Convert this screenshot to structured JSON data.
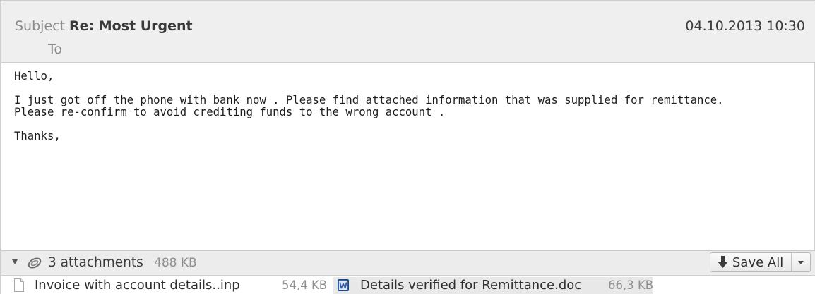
{
  "header": {
    "subject_label": "Subject",
    "subject": "Re: Most Urgent",
    "date": "04.10.2013 10:30",
    "to_label": "To"
  },
  "body": {
    "lines": [
      "Hello,",
      "",
      "I just got off the phone with bank now . Please find attached information that was supplied for remittance.",
      "Please re-confirm to avoid crediting funds to the wrong account .",
      "",
      "Thanks,"
    ]
  },
  "attachments": {
    "count_label": "3 attachments",
    "total_size": "488 KB",
    "save_all_label": "Save All",
    "icons": {
      "collapse": "triangle-down-icon",
      "paperclip": "paperclip-icon",
      "save": "download-arrow-icon",
      "dropdown": "chevron-down-icon"
    },
    "files": [
      {
        "name": "Invoice with account details..inp",
        "size": "54,4 KB",
        "icon": "generic-file-icon"
      },
      {
        "name": "Details verified for Remittance.doc",
        "size": "66,3 KB",
        "icon": "word-doc-icon"
      }
    ]
  },
  "colors": {
    "header_bg": "#efefef",
    "attach_bar_bg": "#ececec",
    "selected_attachment_bg": "#e8e8e8",
    "word_icon_blue": "#2f5fa8"
  }
}
